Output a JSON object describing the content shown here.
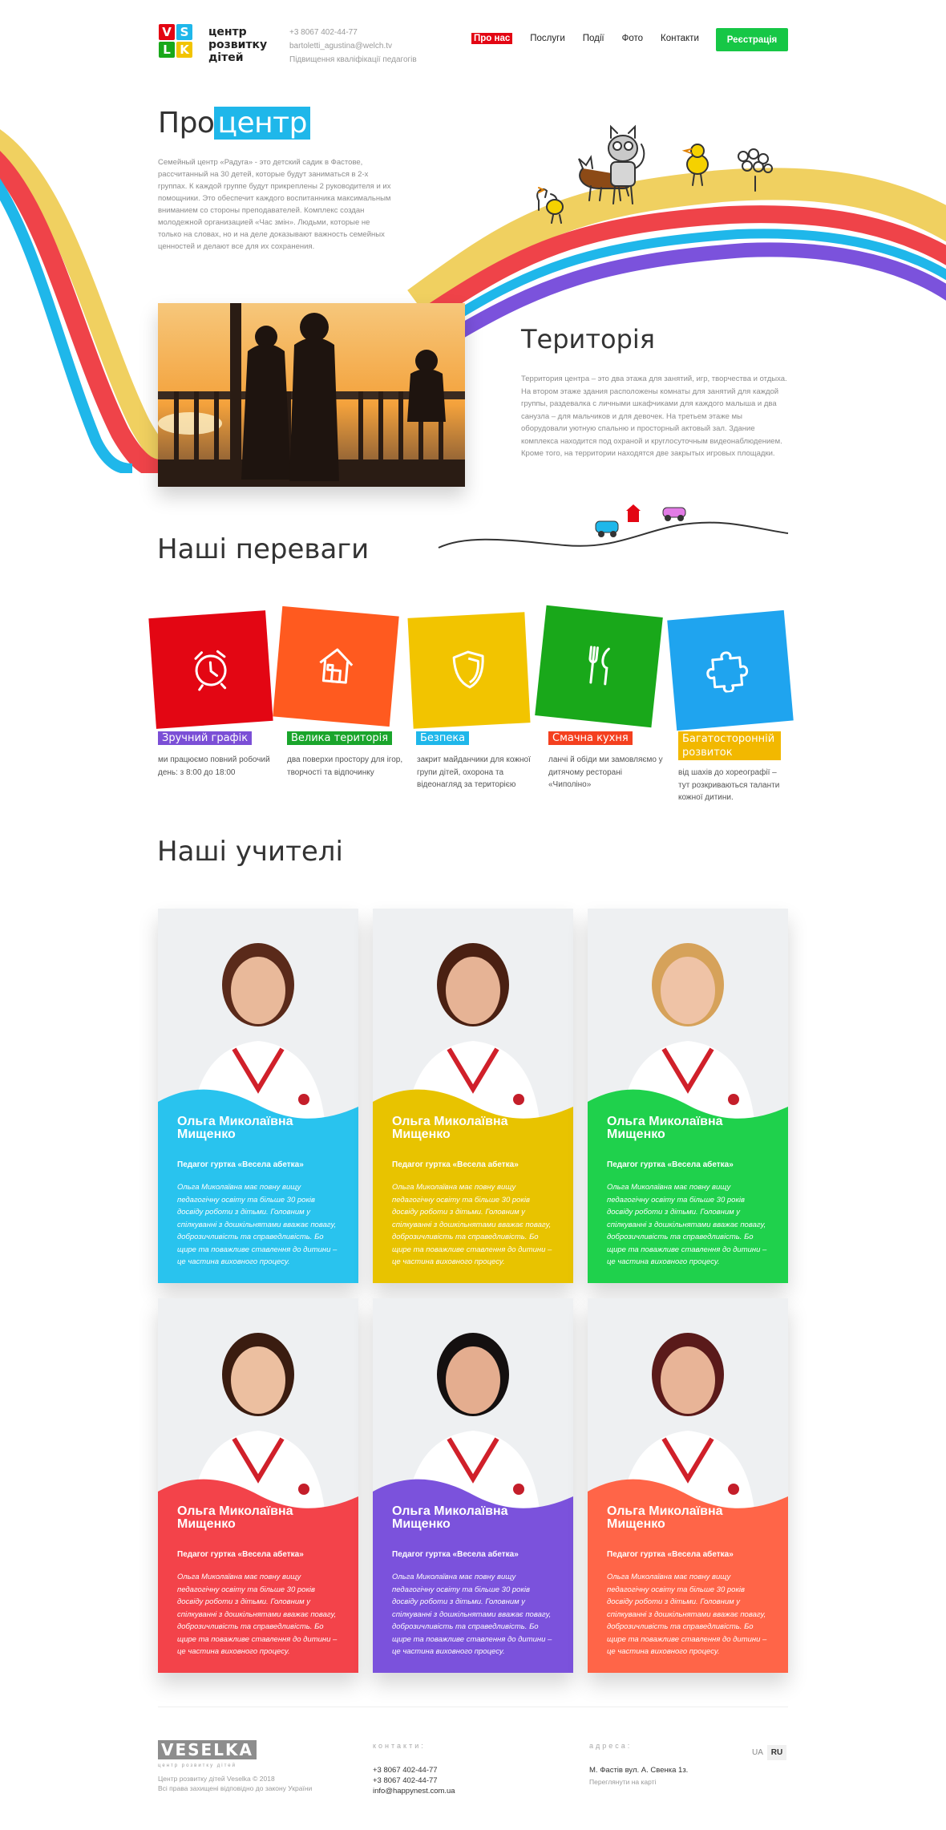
{
  "header": {
    "logo_letters": [
      "V",
      "S",
      "L",
      "K"
    ],
    "logo_lines": [
      "центр",
      "розвитку",
      "дітей"
    ],
    "phone": "+3 8067 402-44-77",
    "email": "bartoletti_agustina@welch.tv",
    "tagline": "Підвищення кваліфікації педагогів",
    "nav": [
      {
        "label": "Про нас",
        "active": true
      },
      {
        "label": "Послуги"
      },
      {
        "label": "Події"
      },
      {
        "label": "Фото"
      },
      {
        "label": "Контакти"
      }
    ],
    "register_label": "Реєстрація"
  },
  "about": {
    "title_a": "Про",
    "title_b": "центр",
    "text": "Семейный центр «Радуга» - это детский садик в Фастове, рассчитанный на 30 детей, которые будут заниматься в 2-х группах. К каждой группе будут прикреплены 2 руководителя и их помощники. Это обеспечит каждого воспитанника максимальным вниманием со стороны преподавателей. Комплекс создан молодежной организацией «Час змін». Людьми, которые не только на словах, но и на деле доказывают важность семейных ценностей и делают все для их сохранения."
  },
  "territory": {
    "title": "Територія",
    "text": "Территория центра – это два этажа для занятий, игр, творчества и отдыха. На втором этаже здания расположены комнаты для занятий для каждой группы, раздевалка с личными шкафчиками для каждого малыша и два санузла – для мальчиков и для девочек. На третьем этаже мы оборудовали уютную спальню и просторный актовый зал. Здание комплекса находится под охраной и круглосуточным видеонаблюдением. Кроме того, на территории находятся две закрытых игровых площадки."
  },
  "advantages": {
    "title": "Наші переваги",
    "items": [
      {
        "label": "Зручний графік",
        "desc": "ми працюємо повний робочий день: з 8:00 до 18:00",
        "icon": "alarm-clock-icon",
        "color": "#e30613",
        "label_color": "#7b4fd6"
      },
      {
        "label": "Велика територія",
        "desc": "два поверхи простору для ігор, творчості та відпочинку",
        "icon": "house-icon",
        "color": "#ff5a1f",
        "label_color": "#1aa52c"
      },
      {
        "label": "Безпека",
        "desc": "закрит майданчики для кожної групи дітей, охорона та відеонагляд за територією",
        "icon": "shield-icon",
        "color": "#f2c400",
        "label_color": "#1fb7ea"
      },
      {
        "label": "Смачна кухня",
        "desc": "ланчі й обіди ми замовляємо у дитячому ресторані «Чиполіно»",
        "icon": "fork-knife-icon",
        "color": "#19a81a",
        "label_color": "#f4401f"
      },
      {
        "label": "Багатосторонній розвиток",
        "desc": "від шахів до хореографії – тут розкриваються таланти кожної дитини.",
        "icon": "puzzle-icon",
        "color": "#1fa4ef",
        "label_color": "#f2b800"
      }
    ]
  },
  "teachers": {
    "title": "Наші учителі",
    "cards": [
      {
        "name": "Ольга Миколаївна Мищенко",
        "role": "Педагог гуртка «Весела абетка»",
        "bio": "Ольга Миколаївна має повну вищу педагогічну освіту та більше 30 років досвіду роботи з дітьми. Головним у спілкуванні з дошкільнятами вважає повагу, доброзичливість та справедливість. Бо щире та поважливе ставлення до дитини – це частина виховного процесу.",
        "color": "#29c3ee"
      },
      {
        "name": "Ольга Миколаївна Мищенко",
        "role": "Педагог гуртка «Весела абетка»",
        "bio": "Ольга Миколаївна має повну вищу педагогічну освіту та більше 30 років досвіду роботи з дітьми. Головним у спілкуванні з дошкільнятами вважає повагу, доброзичливість та справедливість. Бо щире та поважливе ставлення до дитини – це частина виховного процесу.",
        "color": "#e8c300"
      },
      {
        "name": "Ольга Миколаївна Мищенко",
        "role": "Педагог гуртка «Весела абетка»",
        "bio": "Ольга Миколаївна має повну вищу педагогічну освіту та більше 30 років досвіду роботи з дітьми. Головним у спілкуванні з дошкільнятами вважає повагу, доброзичливість та справедливість. Бо щире та поважливе ставлення до дитини – це частина виховного процесу.",
        "color": "#1fd14c"
      },
      {
        "name": "Ольга Миколаївна Мищенко",
        "role": "Педагог гуртка «Весела абетка»",
        "bio": "Ольга Миколаївна має повну вищу педагогічну освіту та більше 30 років досвіду роботи з дітьми. Головним у спілкуванні з дошкільнятами вважає повагу, доброзичливість та справедливість. Бо щире та поважливе ставлення до дитини – це частина виховного процесу.",
        "color": "#f3434a"
      },
      {
        "name": "Ольга Миколаївна Мищенко",
        "role": "Педагог гуртка «Весела абетка»",
        "bio": "Ольга Миколаївна має повну вищу педагогічну освіту та більше 30 років досвіду роботи з дітьми. Головним у спілкуванні з дошкільнятами вважає повагу, доброзичливість та справедливість. Бо щире та поважливе ставлення до дитини – це частина виховного процесу.",
        "color": "#7b52dc"
      },
      {
        "name": "Ольга Миколаївна Мищенко",
        "role": "Педагог гуртка «Весела абетка»",
        "bio": "Ольга Миколаївна має повну вищу педагогічну освіту та більше 30 років досвіду роботи з дітьми. Головним у спілкуванні з дошкільнятами вважає повагу, доброзичливість та справедливість. Бо щире та поважливе ставлення до дитини – це частина виховного процесу.",
        "color": "#ff6548"
      }
    ]
  },
  "footer": {
    "logo": "VESELKA",
    "logo_sub": "центр розвитку дітей",
    "copyright": "Центр розвитку дітей Veselka © 2018",
    "rights": "Всі права захищені відповідно до закону України",
    "contacts_label": "контакти:",
    "phones": [
      "+3 8067 402-44-77",
      "+3 8067 402-44-77"
    ],
    "email": "info@happynest.com.ua",
    "address_label": "адреса:",
    "address": "М. Фастів вул. А. Свенка 1з.",
    "map_link": "Переглянути на карті",
    "langs": [
      {
        "label": "UA",
        "active": false
      },
      {
        "label": "RU",
        "active": true
      }
    ]
  }
}
